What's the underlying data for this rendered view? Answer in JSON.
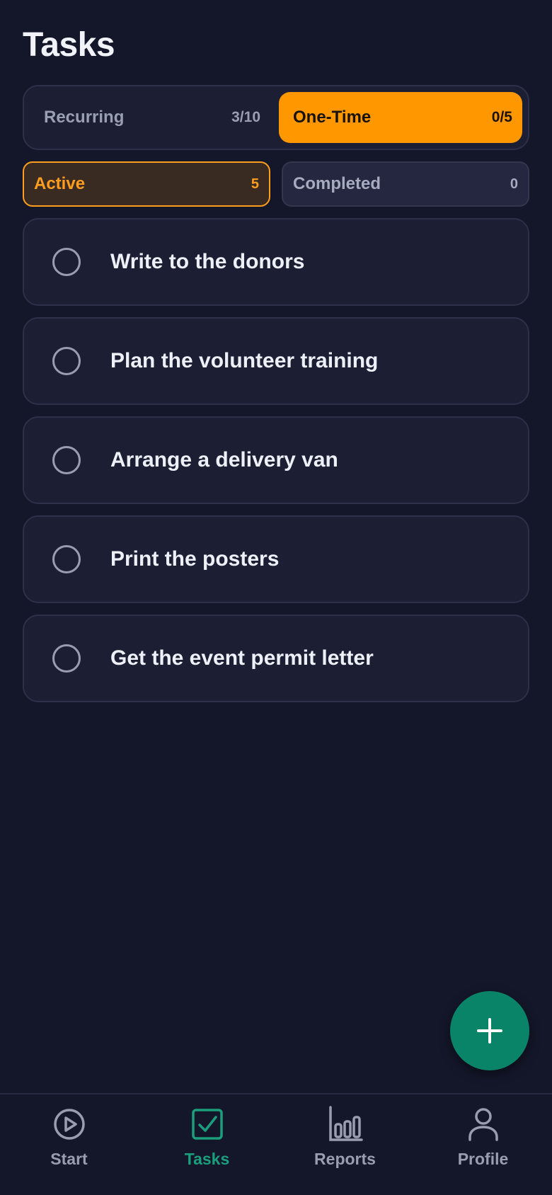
{
  "header": {
    "title": "Tasks"
  },
  "segment": {
    "recurring": {
      "label": "Recurring",
      "count": "3/10"
    },
    "one_time": {
      "label": "One-Time",
      "count": "0/5",
      "selected": true
    }
  },
  "filters": {
    "active": {
      "label": "Active",
      "count": "5",
      "selected": true
    },
    "completed": {
      "label": "Completed",
      "count": "0"
    }
  },
  "tasks": [
    {
      "title": "Write to the donors"
    },
    {
      "title": "Plan the volunteer training"
    },
    {
      "title": "Arrange a delivery van"
    },
    {
      "title": "Print the posters"
    },
    {
      "title": "Get the event permit letter"
    }
  ],
  "fab": {
    "icon": "plus-icon"
  },
  "nav": [
    {
      "label": "Start",
      "icon": "play-circle-icon"
    },
    {
      "label": "Tasks",
      "icon": "checkbox-icon",
      "active": true
    },
    {
      "label": "Reports",
      "icon": "bar-chart-icon"
    },
    {
      "label": "Profile",
      "icon": "person-icon"
    }
  ],
  "colors": {
    "background": "#14172a",
    "accent_orange": "#ff9800",
    "accent_green": "#0a8468",
    "card": "#1c1f33"
  }
}
